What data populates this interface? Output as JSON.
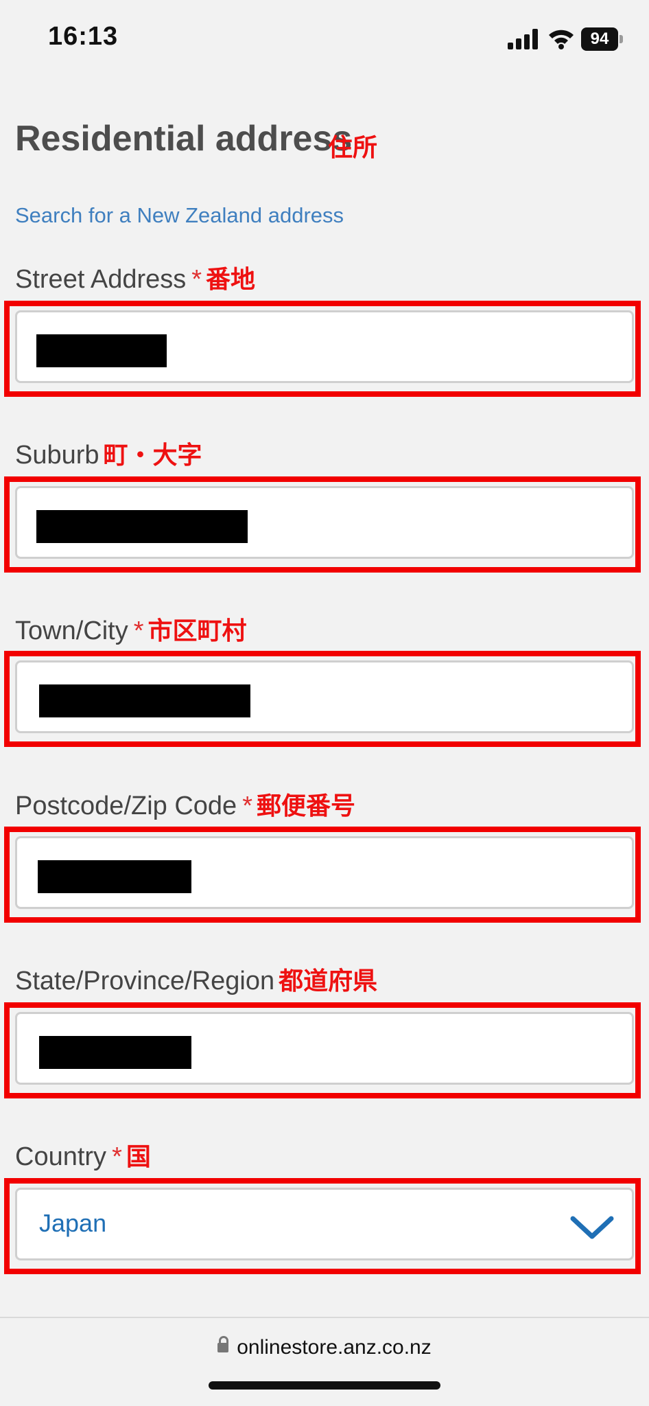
{
  "status_bar": {
    "time": "16:13",
    "battery": "94"
  },
  "page": {
    "title": "Residential address",
    "title_note": "住所",
    "search_link": "Search for a New Zealand address"
  },
  "fields": {
    "street_address": {
      "label": "Street Address",
      "required": "*",
      "note": "番地"
    },
    "suburb": {
      "label": "Suburb",
      "required": "",
      "note": "町・大字"
    },
    "town_city": {
      "label": "Town/City",
      "required": "*",
      "note": "市区町村"
    },
    "postcode": {
      "label": "Postcode/Zip Code",
      "required": "*",
      "note": "郵便番号"
    },
    "state_region": {
      "label": "State/Province/Region",
      "required": "",
      "note": "都道府県"
    },
    "country": {
      "label": "Country",
      "required": "*",
      "note": "国",
      "value": "Japan"
    }
  },
  "browser": {
    "url": "onlinestore.anz.co.nz"
  },
  "colors": {
    "highlight": "#f20000",
    "link": "#3f7fbf",
    "select_text": "#1f6fb5"
  }
}
